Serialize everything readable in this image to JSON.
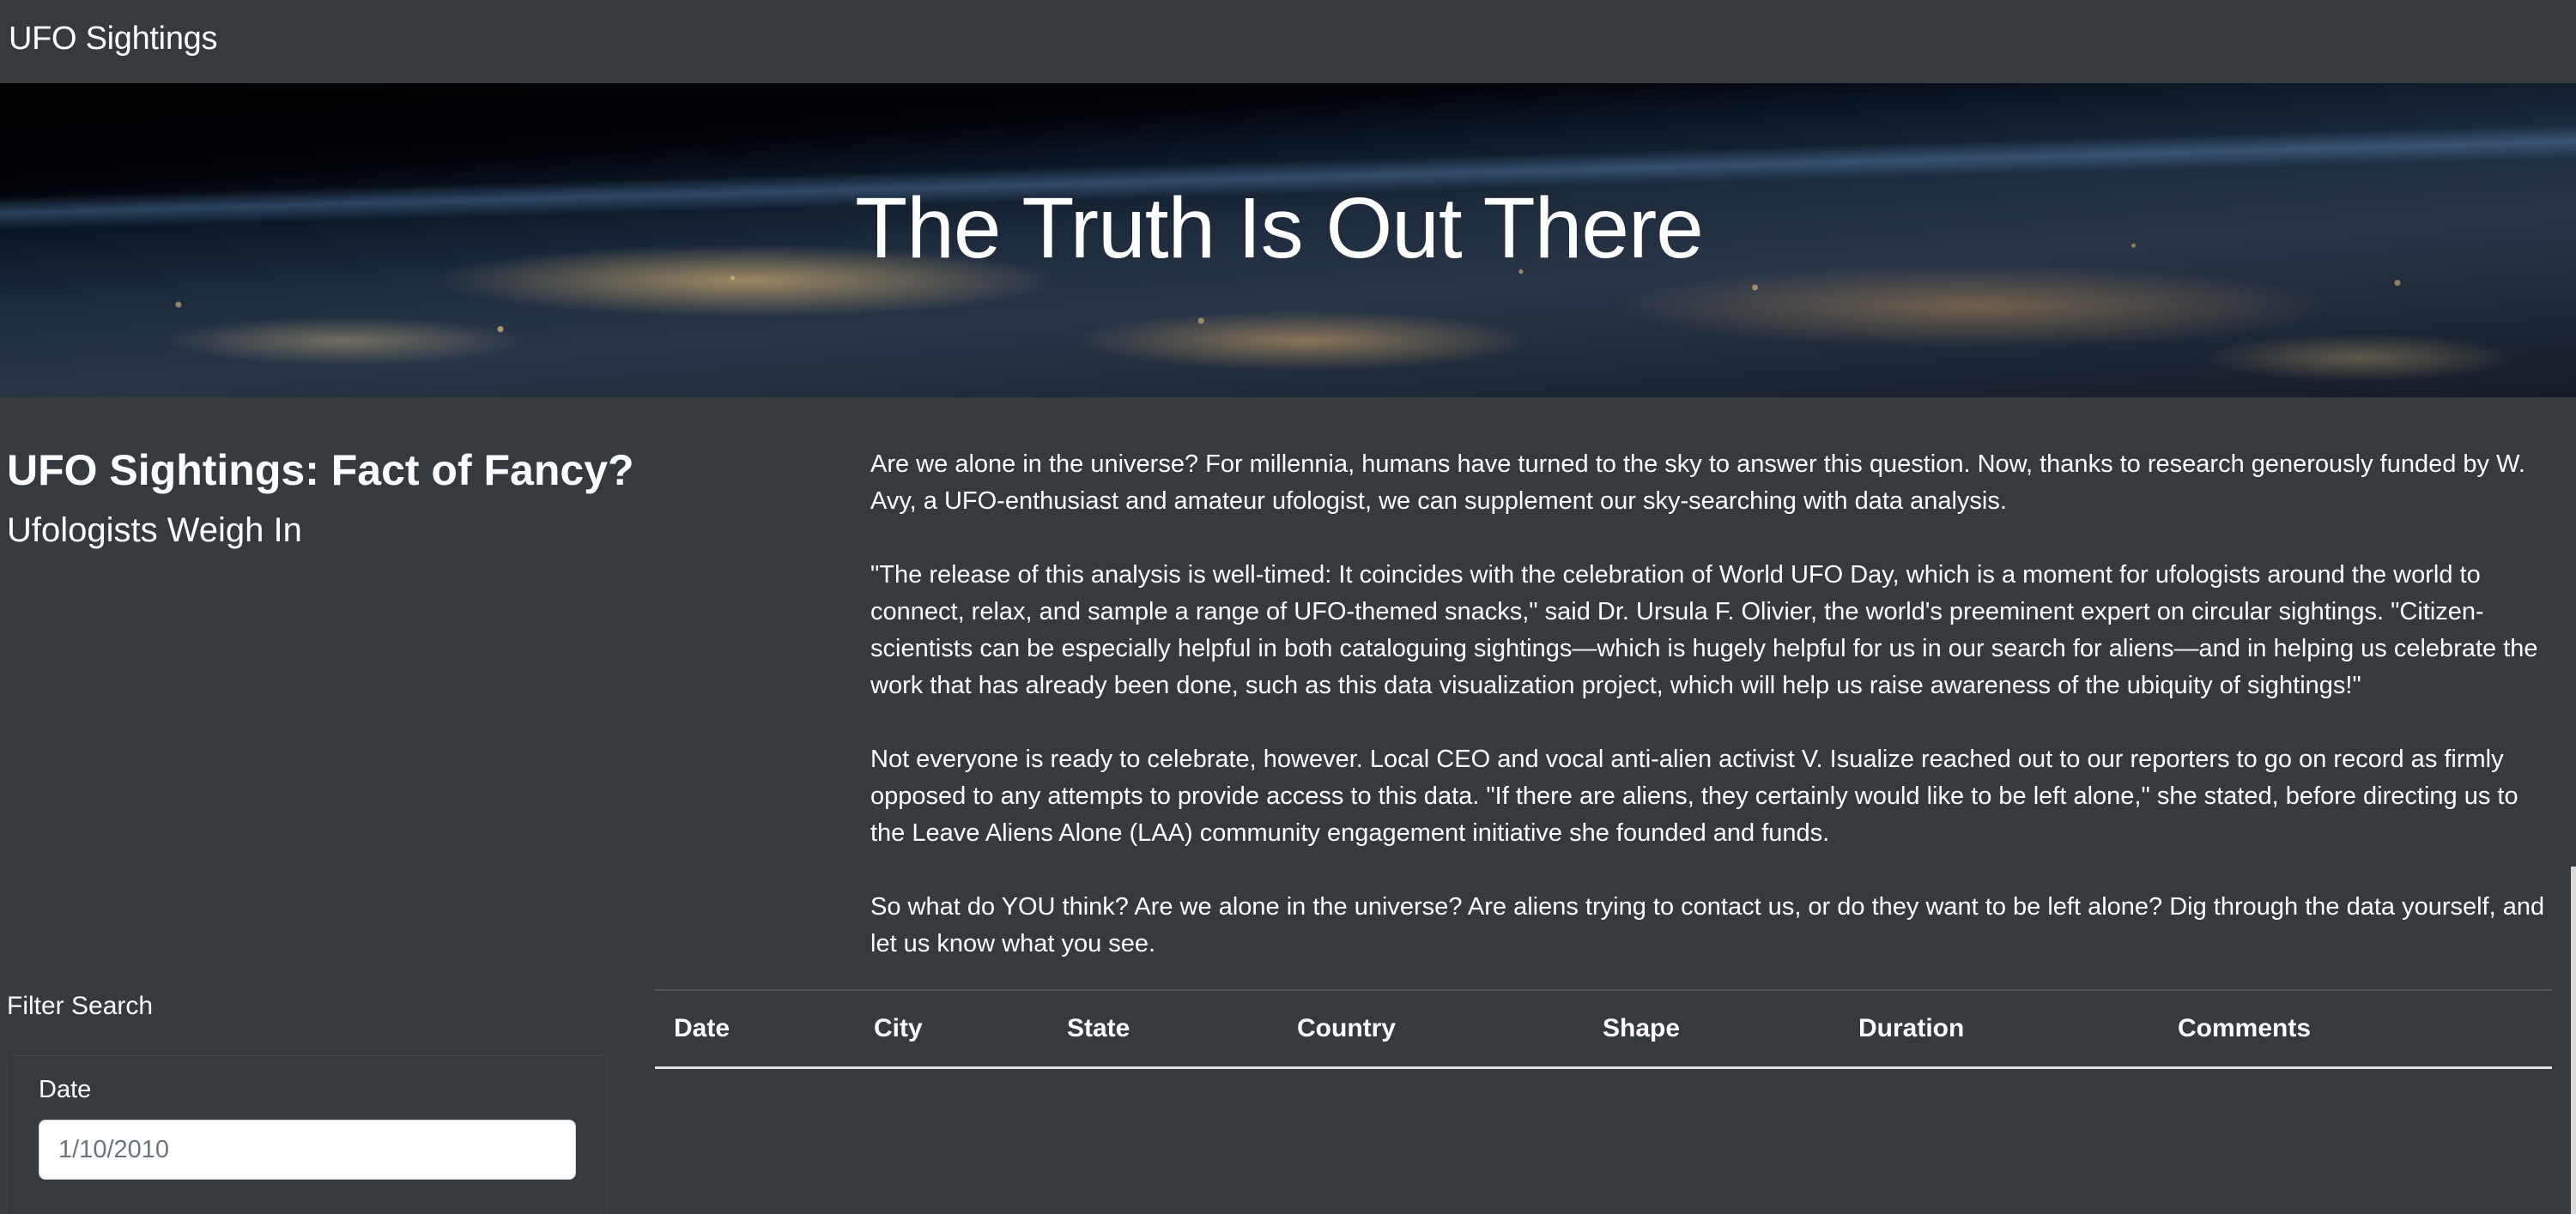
{
  "navbar": {
    "brand": "UFO Sightings"
  },
  "hero": {
    "title": "The Truth Is Out There"
  },
  "article": {
    "heading": "UFO Sightings: Fact of Fancy?",
    "subheading": "Ufologists Weigh In",
    "paragraphs": [
      "Are we alone in the universe? For millennia, humans have turned to the sky to answer this question. Now, thanks to research generously funded by W. Avy, a UFO-enthusiast and amateur ufologist, we can supplement our sky-searching with data analysis.",
      "\"The release of this analysis is well-timed: It coincides with the celebration of World UFO Day, which is a moment for ufologists around the world to connect, relax, and sample a range of UFO-themed snacks,\" said Dr. Ursula F. Olivier, the world's preeminent expert on circular sightings. \"Citizen-scientists can be especially helpful in both cataloguing sightings—which is hugely helpful for us in our search for aliens—and in helping us celebrate the work that has already been done, such as this data visualization project, which will help us raise awareness of the ubiquity of sightings!\"",
      "Not everyone is ready to celebrate, however. Local CEO and vocal anti-alien activist V. Isualize reached out to our reporters to go on record as firmly opposed to any attempts to provide access to this data. \"If there are aliens, they certainly would like to be left alone,\" she stated, before directing us to the Leave Aliens Alone (LAA) community engagement initiative she founded and funds.",
      "So what do YOU think? Are we alone in the universe? Are aliens trying to contact us, or do they want to be left alone? Dig through the data yourself, and let us know what you see."
    ]
  },
  "filter": {
    "title": "Filter Search",
    "date_label": "Date",
    "date_placeholder": "1/10/2010"
  },
  "table": {
    "headers": [
      "Date",
      "City",
      "State",
      "Country",
      "Shape",
      "Duration",
      "Comments"
    ]
  }
}
